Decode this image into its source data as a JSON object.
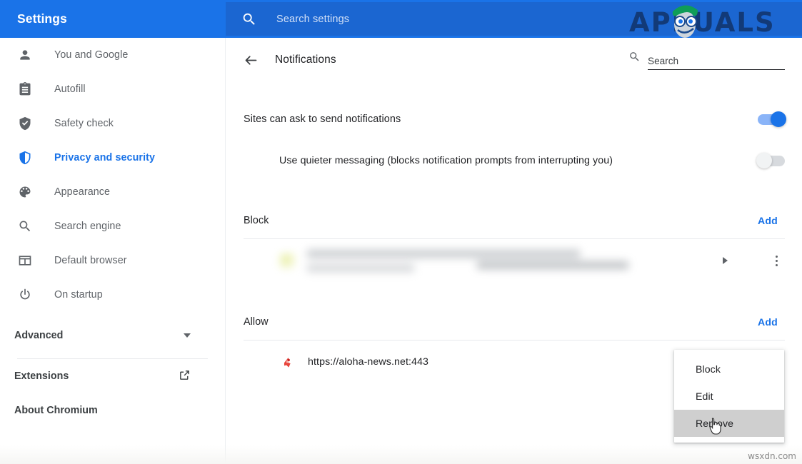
{
  "app": {
    "title": "Settings",
    "watermark_top": "APPUALS",
    "watermark_bottom": "wsxdn.com",
    "accent_color": "#1a73e8",
    "topbar_color": "#1a73e8"
  },
  "global_search": {
    "placeholder": "Search settings",
    "value": "",
    "icon": "search-icon"
  },
  "sidebar": {
    "items": [
      {
        "label": "You and Google",
        "icon": "person-icon",
        "active": false
      },
      {
        "label": "Autofill",
        "icon": "clipboard-icon",
        "active": false
      },
      {
        "label": "Safety check",
        "icon": "shield-check-icon",
        "active": false
      },
      {
        "label": "Privacy and security",
        "icon": "shield-icon",
        "active": true
      },
      {
        "label": "Appearance",
        "icon": "palette-icon",
        "active": false
      },
      {
        "label": "Search engine",
        "icon": "search-icon",
        "active": false
      },
      {
        "label": "Default browser",
        "icon": "browser-window-icon",
        "active": false
      },
      {
        "label": "On startup",
        "icon": "power-icon",
        "active": false
      }
    ],
    "advanced": {
      "label": "Advanced",
      "icon": "chevron-down-icon"
    },
    "bottom": [
      {
        "label": "Extensions",
        "icon": "open-in-new-icon"
      },
      {
        "label": "About Chromium",
        "icon": ""
      }
    ]
  },
  "page": {
    "back_icon": "arrow-left-icon",
    "title": "Notifications",
    "search": {
      "placeholder": "Search",
      "value": "",
      "icon": "search-icon"
    }
  },
  "settings": {
    "primary_toggle": {
      "label": "Sites can ask to send notifications",
      "state": "on"
    },
    "quieter_toggle": {
      "label": "Use quieter messaging (blocks notification prompts from interrupting you)",
      "state": "off"
    }
  },
  "block_section": {
    "title": "Block",
    "add_label": "Add",
    "entries": [
      {
        "url": "",
        "blurred": true,
        "expand_icon": "caret-right-icon",
        "menu_icon": "kebab-menu-icon"
      }
    ]
  },
  "allow_section": {
    "title": "Allow",
    "add_label": "Add",
    "entries": [
      {
        "url": "https://aloha-news.net:443",
        "favicon": "site-favicon",
        "blurred": false
      }
    ]
  },
  "context_menu": {
    "items": [
      {
        "label": "Block",
        "hovered": false
      },
      {
        "label": "Edit",
        "hovered": false
      },
      {
        "label": "Remove",
        "hovered": true
      }
    ]
  }
}
